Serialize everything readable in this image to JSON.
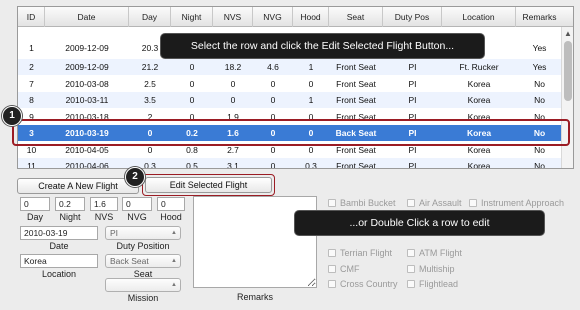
{
  "table": {
    "columns": [
      "ID",
      "Date",
      "Day",
      "Night",
      "NVS",
      "NVG",
      "Hood",
      "Seat",
      "Duty Pos",
      "Location",
      "Remarks"
    ],
    "rows": [
      {
        "id": "1",
        "date": "2009-12-09",
        "day": "20.3",
        "night": "",
        "nvs": "",
        "nvg": "",
        "hood": "",
        "seat": "",
        "duty": "",
        "location": "",
        "remarks": "Yes"
      },
      {
        "id": "2",
        "date": "2009-12-09",
        "day": "21.2",
        "night": "0",
        "nvs": "18.2",
        "nvg": "4.6",
        "hood": "1",
        "seat": "Front Seat",
        "duty": "PI",
        "location": "Ft. Rucker",
        "remarks": "Yes"
      },
      {
        "id": "7",
        "date": "2010-03-08",
        "day": "2.5",
        "night": "0",
        "nvs": "0",
        "nvg": "0",
        "hood": "0",
        "seat": "Front Seat",
        "duty": "PI",
        "location": "Korea",
        "remarks": "No"
      },
      {
        "id": "8",
        "date": "2010-03-11",
        "day": "3.5",
        "night": "0",
        "nvs": "0",
        "nvg": "0",
        "hood": "1",
        "seat": "Front Seat",
        "duty": "PI",
        "location": "Korea",
        "remarks": "No"
      },
      {
        "id": "9",
        "date": "2010-03-18",
        "day": "2",
        "night": "0",
        "nvs": "1.9",
        "nvg": "0",
        "hood": "0",
        "seat": "Front Seat",
        "duty": "PI",
        "location": "Korea",
        "remarks": "No"
      },
      {
        "id": "3",
        "date": "2010-03-19",
        "day": "0",
        "night": "0.2",
        "nvs": "1.6",
        "nvg": "0",
        "hood": "0",
        "seat": "Back Seat",
        "duty": "PI",
        "location": "Korea",
        "remarks": "No"
      },
      {
        "id": "10",
        "date": "2010-04-05",
        "day": "0",
        "night": "0.8",
        "nvs": "2.7",
        "nvg": "0",
        "hood": "0",
        "seat": "Front Seat",
        "duty": "PI",
        "location": "Korea",
        "remarks": "No"
      },
      {
        "id": "11",
        "date": "2010-04-06",
        "day": "0.3",
        "night": "0.5",
        "nvs": "3.1",
        "nvg": "0",
        "hood": "0.3",
        "seat": "Front Seat",
        "duty": "PI",
        "location": "Korea",
        "remarks": "No"
      }
    ]
  },
  "callouts": {
    "edit_hint": "Select the row and click the Edit Selected Flight Button...",
    "double_click_hint": "...or Double Click a row to edit",
    "step1": "1",
    "step2": "2"
  },
  "buttons": {
    "create": "Create A New Flight",
    "edit": "Edit Selected Flight"
  },
  "form": {
    "day": {
      "value": "0",
      "label": "Day"
    },
    "night": {
      "value": "0.2",
      "label": "Night"
    },
    "nvs": {
      "value": "1.6",
      "label": "NVS"
    },
    "nvg": {
      "value": "0",
      "label": "NVG"
    },
    "hood": {
      "value": "0",
      "label": "Hood"
    },
    "date": {
      "value": "2010-03-19",
      "label": "Date"
    },
    "duty": {
      "value": "PI",
      "label": "Duty Position"
    },
    "location": {
      "value": "Korea",
      "label": "Location"
    },
    "seat": {
      "value": "Back Seat",
      "label": "Seat"
    },
    "mission": {
      "value": "",
      "label": "Mission"
    },
    "remarks_label": "Remarks"
  },
  "checkboxes": {
    "bambi": "Bambi Bucket",
    "air_assault": "Air Assault",
    "instrument": "Instrument Approach",
    "terrain": "Terrian Flight",
    "atm": "ATM Flight",
    "cmf": "CMF",
    "multiship": "Multiship",
    "cross_country": "Cross Country",
    "flightlead": "Flightlead"
  },
  "colors": {
    "selection": "#3a7bd5",
    "highlight_border": "#9b1c24",
    "callout_bg": "#1b1b1b"
  }
}
